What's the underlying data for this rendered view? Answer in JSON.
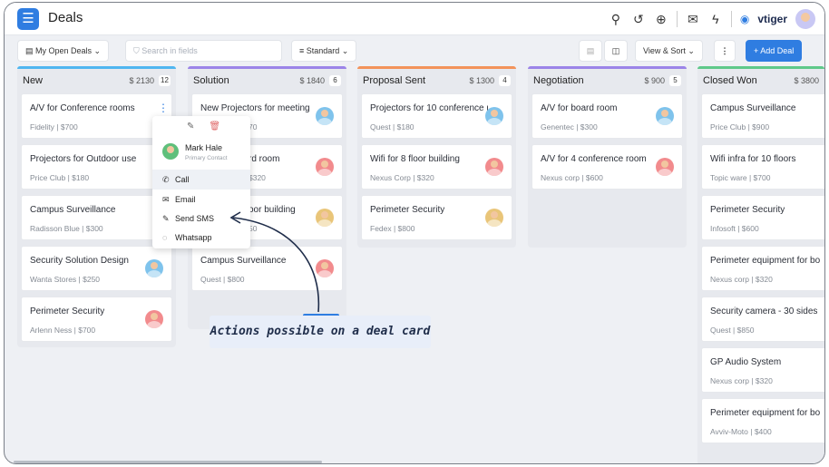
{
  "app": {
    "title": "Deals",
    "brand": "vtiger"
  },
  "toolbar": {
    "filter_label": "My Open Deals",
    "search_placeholder": "Search in fields",
    "view_label": "Standard",
    "viewsort_label": "View & Sort",
    "add_label": "+ Add Deal"
  },
  "columns": [
    {
      "name": "New",
      "amount": "$ 2130",
      "count": "12",
      "color": "#4fb6f0",
      "cards": [
        {
          "title": "A/V for Conference rooms",
          "sub": "Fidelity | $700",
          "avatar": "none"
        },
        {
          "title": "Projectors for Outdoor use",
          "sub": "Price Club | $180",
          "avatar": "none"
        },
        {
          "title": "Campus Surveillance",
          "sub": "Radisson Blue | $300",
          "avatar": "none"
        },
        {
          "title": "Security Solution Design",
          "sub": "Wanta Stores | $250",
          "avatar": "blue"
        },
        {
          "title": "Perimeter Security",
          "sub": "Arlenn Ness | $700",
          "avatar": "red"
        }
      ]
    },
    {
      "name": "Solution",
      "amount": "$ 1840",
      "count": "6",
      "color": "#9b84e8",
      "cards": [
        {
          "title": "New Projectors for meeting",
          "sub": "70",
          "avatar": "blue"
        },
        {
          "title": "rd room",
          "sub": "$320",
          "avatar": "red"
        },
        {
          "title": "oor building",
          "sub": "50",
          "avatar": "yellow"
        },
        {
          "title": "Campus Surveillance",
          "sub": "Quest | $800",
          "avatar": "red"
        }
      ]
    },
    {
      "name": "Proposal Sent",
      "amount": "$ 1300",
      "count": "4",
      "color": "#f3935a",
      "cards": [
        {
          "title": "Projectors for 10 conference ro...",
          "sub": "Quest | $180",
          "avatar": "blue"
        },
        {
          "title": "Wifi for 8 floor building",
          "sub": "Nexus Corp | $320",
          "avatar": "red"
        },
        {
          "title": "Perimeter Security",
          "sub": "Fedex | $800",
          "avatar": "yellow"
        }
      ]
    },
    {
      "name": "Negotiation",
      "amount": "$ 900",
      "count": "5",
      "color": "#9b84e8",
      "cards": [
        {
          "title": "A/V for board room",
          "sub": "Genentec | $300",
          "avatar": "blue"
        },
        {
          "title": "A/V for 4 conference room",
          "sub": "Nexus corp | $600",
          "avatar": "red"
        }
      ]
    },
    {
      "name": "Closed Won",
      "amount": "$ 3800",
      "count": "",
      "color": "#5fc98a",
      "cards": [
        {
          "title": "Campus Surveillance",
          "sub": "Price Club | $900",
          "avatar": "none"
        },
        {
          "title": "Wifi infra for 10 floors",
          "sub": "Topic ware | $700",
          "avatar": "none"
        },
        {
          "title": "Perimeter Security",
          "sub": "Infosoft | $600",
          "avatar": "none"
        },
        {
          "title": "Perimeter equipment for bo",
          "sub": "Nexus corp | $320",
          "avatar": "none"
        },
        {
          "title": "Security camera - 30 sides",
          "sub": "Quest | $850",
          "avatar": "none"
        },
        {
          "title": "GP Audio System",
          "sub": "Nexus corp | $320",
          "avatar": "none"
        },
        {
          "title": "Perimeter equipment for bo",
          "sub": "Avviv-Moto | $400",
          "avatar": "none"
        }
      ]
    }
  ],
  "popover": {
    "contact_name": "Mark Hale",
    "contact_role": "Primary Contact",
    "actions": [
      "Call",
      "Email",
      "Send SMS",
      "Whatsapp"
    ]
  },
  "callout": "Actions possible on a deal card"
}
